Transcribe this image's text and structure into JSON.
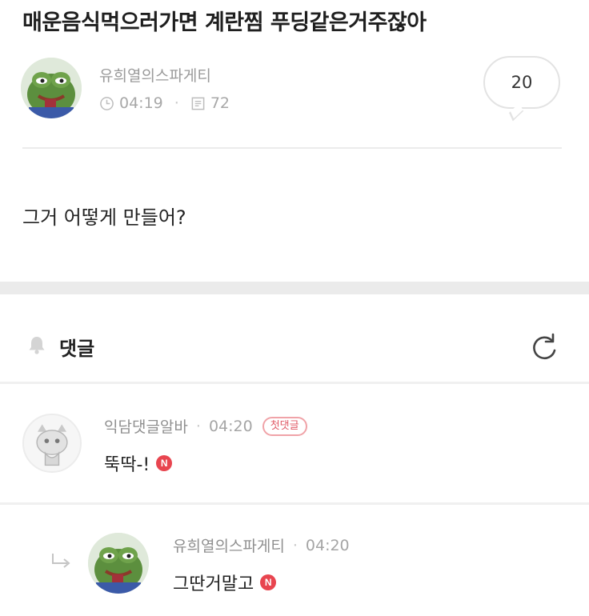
{
  "post": {
    "title": "매운음식먹으러가면 계란찜 푸딩같은거주잖아",
    "author": "유희열의스파게티",
    "time": "04:19",
    "views": "72",
    "comment_count": "20",
    "body": "그거 어떻게 만들어?"
  },
  "comments_section": {
    "title": "댓글",
    "icons": {
      "notify": "bell-icon",
      "refresh": "refresh-icon"
    }
  },
  "comments": [
    {
      "author": "익담댓글알바",
      "time": "04:20",
      "badge": "첫댓글",
      "text": "뚝딱-!",
      "new_badge": "N"
    },
    {
      "author": "유희열의스파게티",
      "time": "04:20",
      "text": "그딴거말고",
      "new_badge": "N",
      "is_reply": true
    }
  ],
  "colors": {
    "accent_new": "#e8454f",
    "first_badge": "#e05a66",
    "muted_text": "#9a9a9a"
  }
}
